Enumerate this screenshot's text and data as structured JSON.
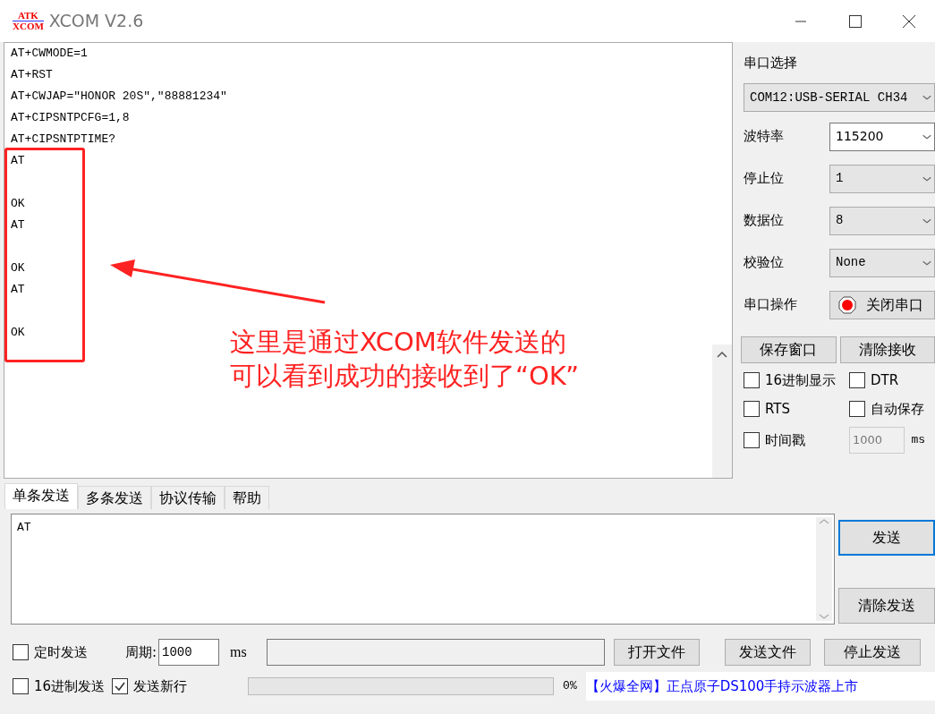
{
  "window": {
    "title": "XCOM V2.6",
    "logo": {
      "top": "ATK",
      "bottom": "XCOM"
    }
  },
  "receive": {
    "lines": [
      {
        "kind": "text",
        "text": "AT+CWMODE=1"
      },
      {
        "kind": "text",
        "text": "AT+RST"
      },
      {
        "kind": "text",
        "text": "AT+CWJAP=\"HONOR 20S\",\"88881234\""
      },
      {
        "kind": "text",
        "text": "AT+CIPSNTPCFG=1,8"
      },
      {
        "kind": "text",
        "text": "AT+CIPSNTPTIME?"
      },
      {
        "kind": "text",
        "text": "AT"
      },
      {
        "kind": "blank"
      },
      {
        "kind": "text",
        "text": "OK"
      },
      {
        "kind": "text",
        "text": "AT"
      },
      {
        "kind": "blank"
      },
      {
        "kind": "text",
        "text": "OK"
      },
      {
        "kind": "text",
        "text": "AT"
      },
      {
        "kind": "blank"
      },
      {
        "kind": "text",
        "text": "OK"
      }
    ],
    "annotation": {
      "lines": [
        "这里是通过XCOM软件发送的",
        "可以看到成功的接收到了“OK”"
      ]
    }
  },
  "serial": {
    "port_label": "串口选择",
    "port_value": "COM12:USB-SERIAL CH34",
    "settings": [
      {
        "label": "波特率",
        "value": "115200",
        "kind": "editable"
      },
      {
        "label": "停止位",
        "value": "1",
        "kind": "dropdown"
      },
      {
        "label": "数据位",
        "value": "8",
        "kind": "dropdown"
      },
      {
        "label": "校验位",
        "value": "None",
        "kind": "dropdown"
      }
    ],
    "operation": {
      "label": "串口操作",
      "button": "关闭串口",
      "on": true
    },
    "buttons": [
      "保存窗口",
      "清除接收"
    ],
    "options": [
      {
        "label": "16进制显示",
        "checked": false
      },
      {
        "label": "DTR",
        "checked": false
      },
      {
        "label": "RTS",
        "checked": false
      },
      {
        "label": "自动保存",
        "checked": false
      }
    ],
    "timestamp": {
      "label": "时间戳",
      "checked": false,
      "interval": "1000",
      "unit": "ms"
    }
  },
  "tabs": [
    {
      "label": "单条发送",
      "selected": true
    },
    {
      "label": "多条发送",
      "selected": false
    },
    {
      "label": "协议传输",
      "selected": false
    },
    {
      "label": "帮助",
      "selected": false
    }
  ],
  "send": {
    "text": "AT",
    "buttons": [
      {
        "label": "发送",
        "focused": true
      },
      {
        "label": "清除发送",
        "focused": false
      }
    ]
  },
  "bottom": {
    "timed_send": {
      "label": "定时发送",
      "checked": false
    },
    "period_label": "周期:",
    "period_value": "1000",
    "period_unit": "ms",
    "file_buttons": [
      "打开文件",
      "发送文件",
      "停止发送"
    ],
    "hex_send": {
      "label": "16进制发送",
      "checked": false
    },
    "send_newline": {
      "label": "发送新行",
      "checked": true
    },
    "progress": {
      "level": 0,
      "reading": "0%"
    },
    "ad": "【火爆全网】正点原子DS100手持示波器上市"
  }
}
